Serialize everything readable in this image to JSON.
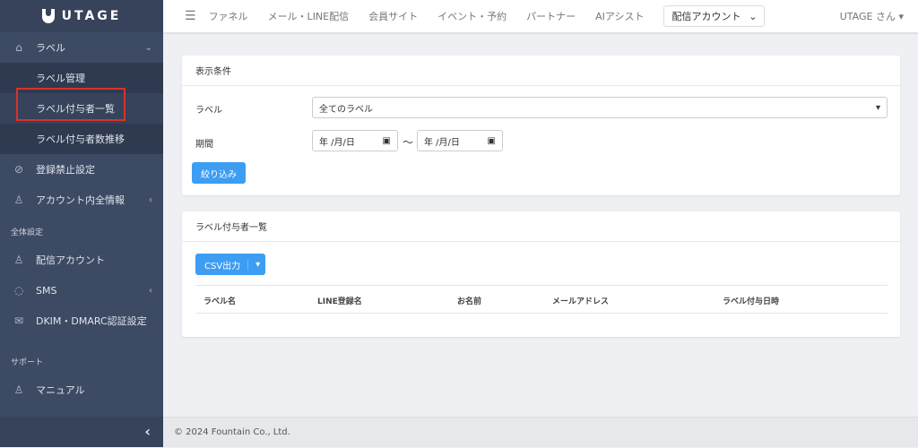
{
  "sidebar": {
    "brand": "UTAGE",
    "label_menu": "ラベル",
    "sub_items": [
      "ラベル管理",
      "ラベル付与者一覧",
      "ラベル付与者数推移"
    ],
    "items1": [
      "登録禁止設定",
      "アカウント内全情報"
    ],
    "section1": "全体設定",
    "items2": [
      "配信アカウント",
      "SMS",
      "DKIM・DMARC認証設定"
    ],
    "section2": "サポート",
    "items3": [
      "マニュアル"
    ]
  },
  "topbar": {
    "nav": [
      "ファネル",
      "メール・LINE配信",
      "会員サイト",
      "イベント・予約",
      "パートナー",
      "AIアシスト"
    ],
    "account_select": "配信アカウント",
    "user": "UTAGE さん"
  },
  "filter": {
    "title": "表示条件",
    "label_label": "ラベル",
    "label_value": "全てのラベル",
    "period_label": "期間",
    "date_placeholder": "年 /月/日",
    "tilde": "〜",
    "submit": "絞り込み"
  },
  "list": {
    "title": "ラベル付与者一覧",
    "csv": "CSV出力",
    "columns": [
      "ラベル名",
      "LINE登録名",
      "お名前",
      "メールアドレス",
      "ラベル付与日時"
    ]
  },
  "footer": "© 2024 Fountain Co., Ltd."
}
